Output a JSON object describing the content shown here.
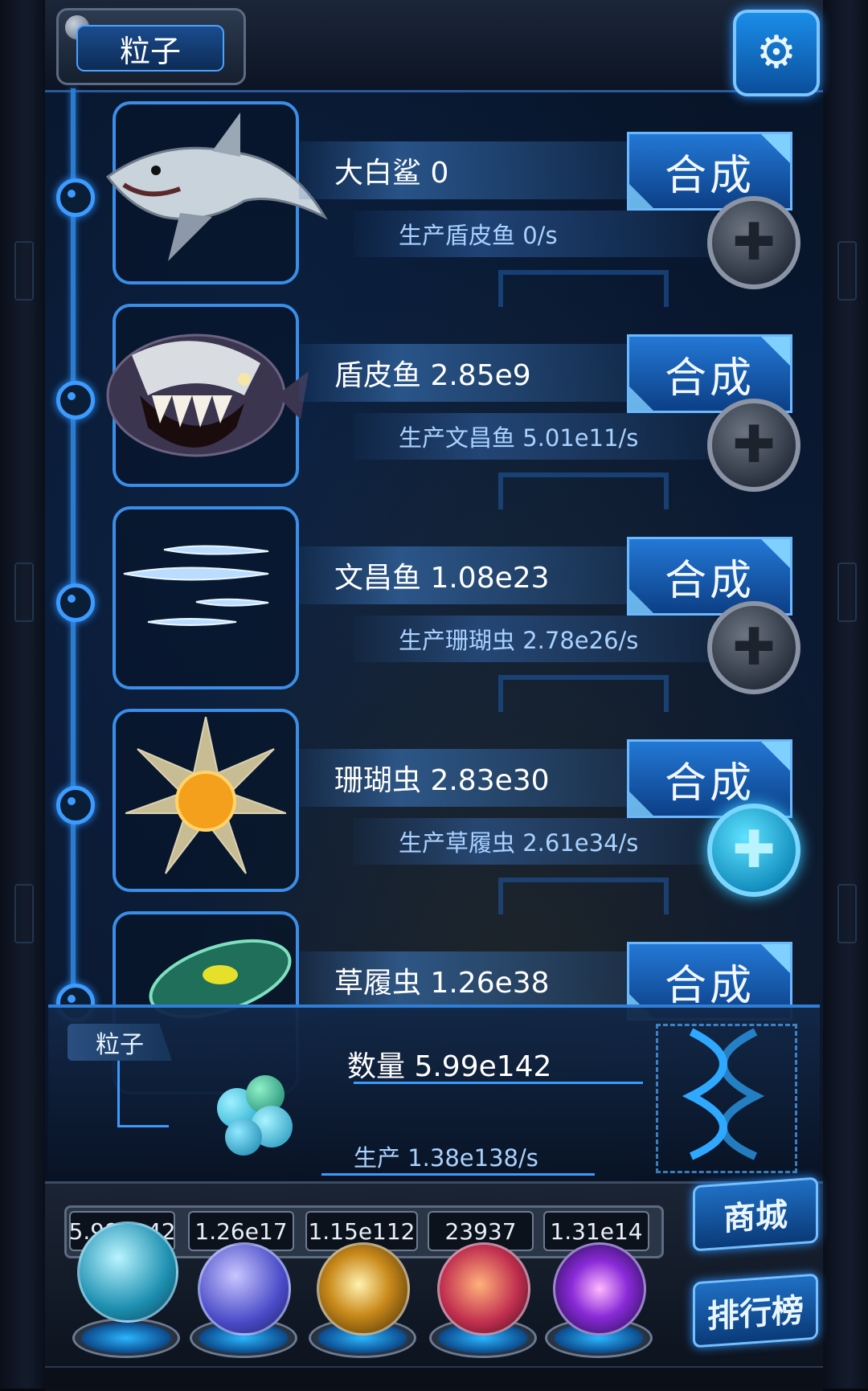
{
  "header": {
    "title": "粒子",
    "settings_icon": "gear-icon"
  },
  "creatures": [
    {
      "name_value": "大白鲨 0",
      "synth_label": "合成",
      "production": "生产盾皮鱼 0/s",
      "plus_active": false,
      "icon": "shark-icon"
    },
    {
      "name_value": "盾皮鱼 2.85e9",
      "synth_label": "合成",
      "production": "生产文昌鱼 5.01e11/s",
      "plus_active": false,
      "icon": "armored-fish-icon"
    },
    {
      "name_value": "文昌鱼 1.08e23",
      "synth_label": "合成",
      "production": "生产珊瑚虫 2.78e26/s",
      "plus_active": false,
      "icon": "lancelet-icon"
    },
    {
      "name_value": "珊瑚虫 2.83e30",
      "synth_label": "合成",
      "production": "生产草履虫 2.61e34/s",
      "plus_active": true,
      "icon": "coral-polyp-icon"
    },
    {
      "name_value": "草履虫 1.26e38",
      "synth_label": "合成",
      "production": "",
      "plus_active": false,
      "icon": "paramecium-icon"
    }
  ],
  "particle_panel": {
    "tag": "粒子",
    "quantity": "数量 5.99e142",
    "production": "生产 1.38e138/s"
  },
  "resources": {
    "counters": [
      "5.99e142",
      "1.26e17",
      "1.15e112",
      "23937",
      "1.31e14"
    ],
    "orbs": [
      "particle-orb",
      "lightning-orb",
      "galaxy-orb",
      "brain-orb",
      "vortex-orb"
    ]
  },
  "side_buttons": {
    "shop": "商城",
    "leaderboard": "排行榜"
  },
  "colors": {
    "accent": "#3c9bff",
    "button": "#1f6fc4",
    "text": "#ffffff"
  }
}
